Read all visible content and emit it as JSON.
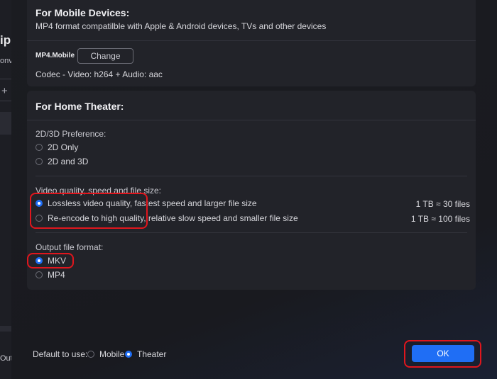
{
  "background_app": {
    "title_fragment": "ipp",
    "subtitle_fragment": "onv",
    "plus_glyph": "+",
    "bottom_fragment": "Outp"
  },
  "mobile": {
    "title": "For Mobile Devices:",
    "description": "MP4 format compatilble with Apple & Android devices, TVs and other devices",
    "format_name": "MP4.Mobile",
    "change_label": "Change",
    "codec": "Codec - Video: h264 + Audio: aac"
  },
  "home": {
    "title": "For Home Theater:",
    "pref_label": "2D/3D Preference:",
    "pref_options": [
      {
        "label": "2D Only",
        "selected": false
      },
      {
        "label": "2D and 3D",
        "selected": false
      }
    ],
    "quality_label": "Video quality, speed and file size:",
    "quality_options": [
      {
        "label": "Lossless video quality, fastest speed and larger file size",
        "size": "1 TB ≈ 30 files",
        "selected": true
      },
      {
        "label": "Re-encode to high quality, relative slow speed and smaller file size",
        "size": "1 TB ≈ 100 files",
        "selected": false
      }
    ],
    "format_label": "Output file format:",
    "format_options": [
      {
        "label": "MKV",
        "selected": true
      },
      {
        "label": "MP4",
        "selected": false
      }
    ]
  },
  "footer": {
    "default_label": "Default to use:",
    "options": [
      {
        "label": "Mobile",
        "selected": false
      },
      {
        "label": "Theater",
        "selected": true
      }
    ],
    "ok_label": "OK"
  },
  "colors": {
    "accent": "#1f6ef5",
    "highlight": "#e0161d",
    "card_bg": "#222329",
    "dialog_bg": "#1b1c21"
  }
}
